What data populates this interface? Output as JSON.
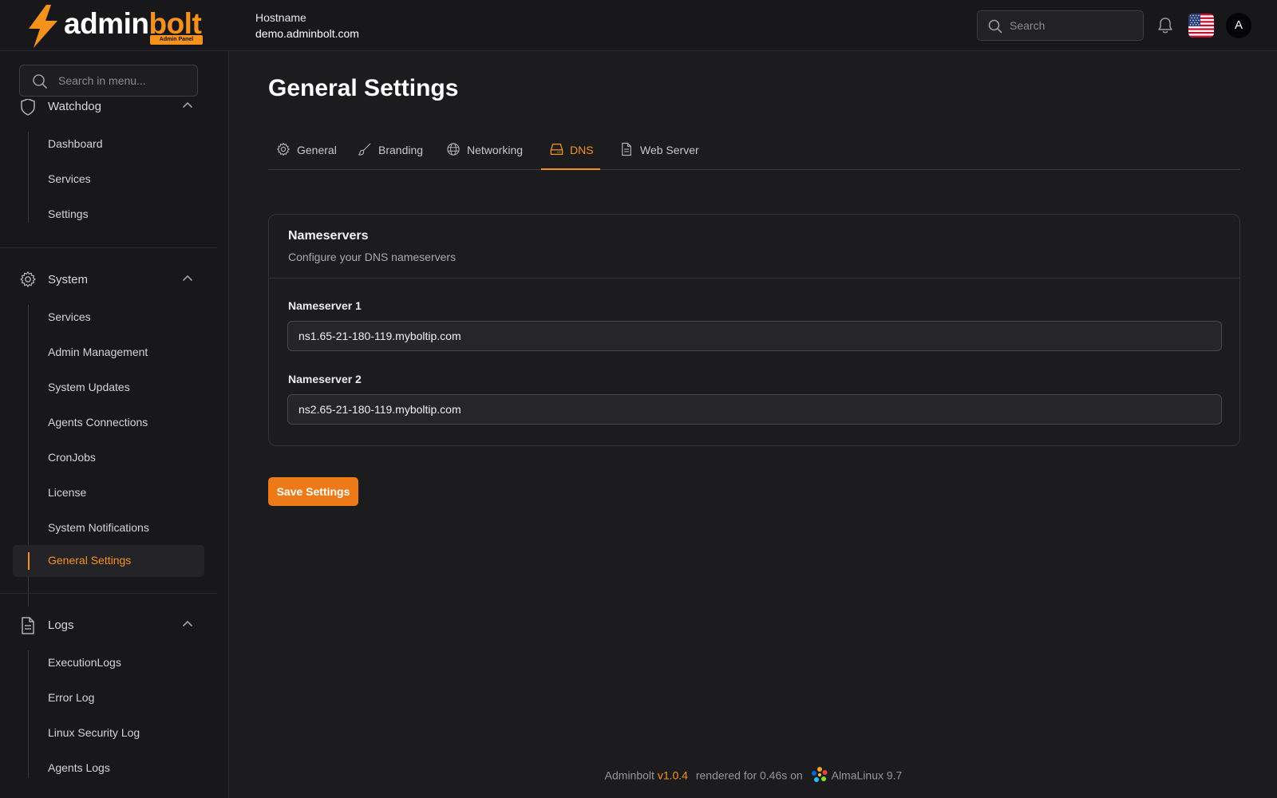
{
  "brand": {
    "word_1": "admin",
    "word_2": "bolt",
    "badge": "Admin Panel"
  },
  "header": {
    "hostname_label": "Hostname",
    "hostname_value": "demo.adminbolt.com",
    "search_placeholder": "Search",
    "avatar_initial": "A",
    "language_icon": "us-flag-icon",
    "notification_icon": "bell-icon"
  },
  "sidebar": {
    "search_placeholder": "Search in menu...",
    "groups": [
      {
        "label": "Watchdog",
        "icon": "shield-icon",
        "items": [
          "Dashboard",
          "Services",
          "Settings"
        ]
      },
      {
        "label": "System",
        "icon": "gear-icon",
        "items": [
          "Services",
          "Admin Management",
          "System Updates",
          "Agents Connections",
          "CronJobs",
          "License",
          "System Notifications",
          "General Settings"
        ]
      },
      {
        "label": "Logs",
        "icon": "document-icon",
        "items": [
          "ExecutionLogs",
          "Error Log",
          "Linux Security Log",
          "Agents Logs"
        ]
      }
    ],
    "active_item": "General Settings"
  },
  "page": {
    "title": "General Settings",
    "tabs": [
      {
        "label": "General",
        "icon": "gear-icon"
      },
      {
        "label": "Branding",
        "icon": "brush-icon"
      },
      {
        "label": "Networking",
        "icon": "globe-icon"
      },
      {
        "label": "DNS",
        "icon": "drive-icon"
      },
      {
        "label": "Web Server",
        "icon": "document-icon"
      }
    ],
    "active_tab": "DNS",
    "card": {
      "title": "Nameservers",
      "subtitle": "Configure your DNS nameservers",
      "fields": [
        {
          "label": "Nameserver 1",
          "value": "ns1.65-21-180-119.myboltip.com"
        },
        {
          "label": "Nameserver 2",
          "value": "ns2.65-21-180-119.myboltip.com"
        }
      ]
    },
    "save_label": "Save Settings"
  },
  "footer": {
    "app_name": "Adminbolt",
    "version": "v1.0.4",
    "render_text": "rendered for 0.46s on",
    "os": "AlmaLinux 9.7"
  },
  "colors": {
    "accent": "#f5921e",
    "button": "#ee7a17",
    "background": "#1c1c1f",
    "sidebar": "#18181b"
  }
}
